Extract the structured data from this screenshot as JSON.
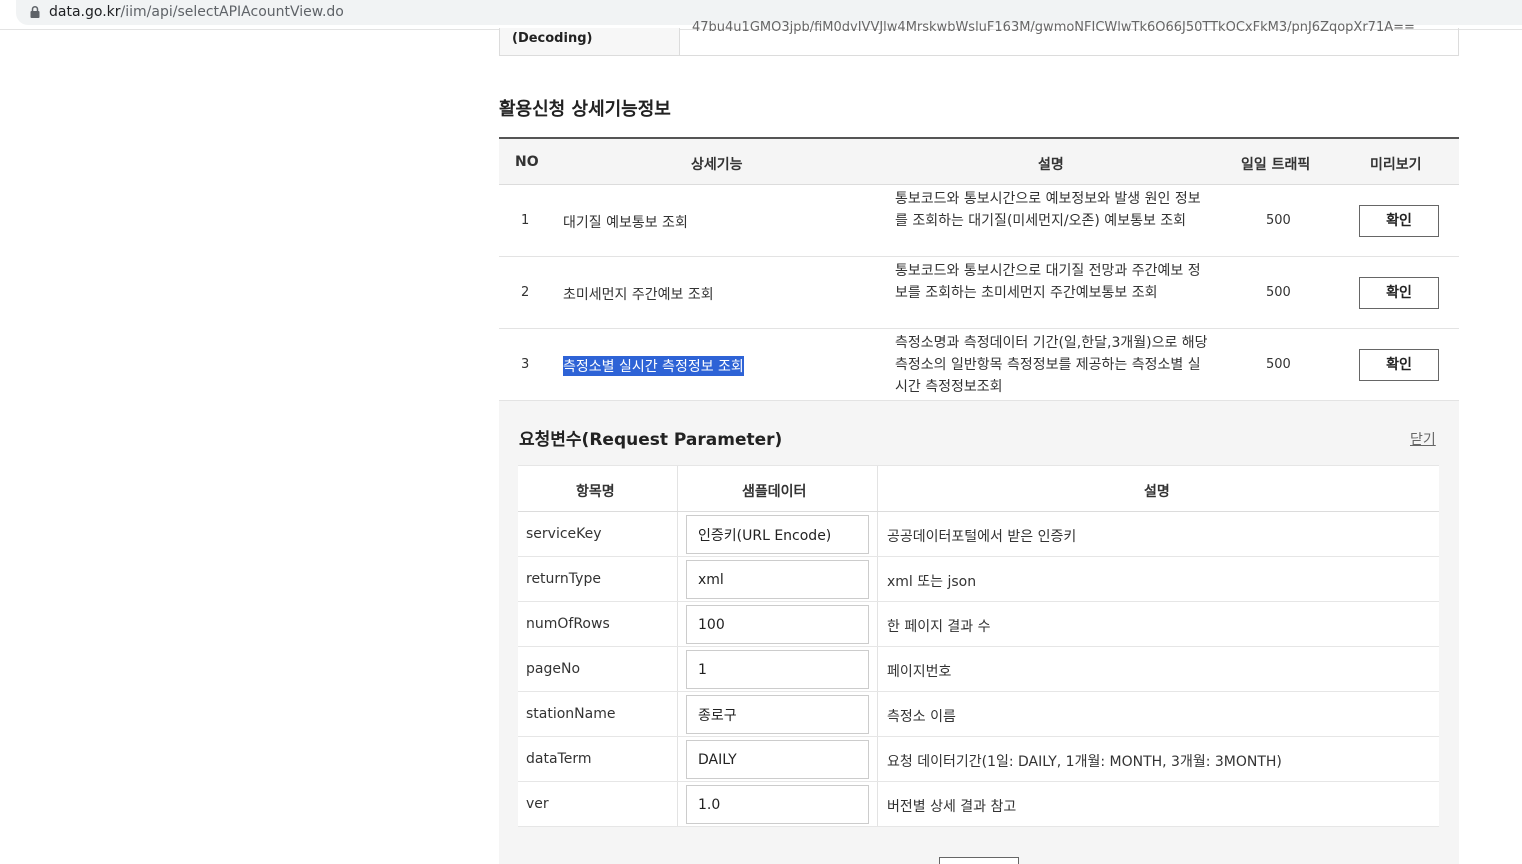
{
  "browser": {
    "url_host": "data.go.kr",
    "url_path": "/iim/api/selectAPIAcountView.do"
  },
  "key_row": {
    "label": "(Decoding)",
    "value": "47bu4u1GMO3jpb/fiM0dvIVVJlw4MrskwbWsluF163M/gwmoNFICWlwTk6O66J50TTkOCxFkM3/pnJ6ZqopXr71A=="
  },
  "feature_section": {
    "title": "활용신청 상세기능정보",
    "headers": {
      "no": "NO",
      "feature": "상세기능",
      "desc": "설명",
      "traffic": "일일 트래픽",
      "preview": "미리보기"
    },
    "rows": [
      {
        "no": "1",
        "name": "대기질 예보통보 조회",
        "desc": "통보코드와 통보시간으로 예보정보와 발생 원인 정보를 조회하는 대기질(미세먼지/오존) 예보통보 조회",
        "traffic": "500",
        "button": "확인",
        "selected": false
      },
      {
        "no": "2",
        "name": "초미세먼지 주간예보 조회",
        "desc": "통보코드와 통보시간으로 대기질 전망과 주간예보 정보를 조회하는 초미세먼지 주간예보통보 조회",
        "traffic": "500",
        "button": "확인",
        "selected": false
      },
      {
        "no": "3",
        "name": "측정소별 실시간 측정정보 조회",
        "desc": "측정소명과 측정데이터 기간(일,한달,3개월)으로 해당 측정소의 일반항목 측정정보를 제공하는 측정소별 실시간 측정정보조회",
        "traffic": "500",
        "button": "확인",
        "selected": true
      }
    ]
  },
  "request_panel": {
    "title": "요청변수(Request Parameter)",
    "close_label": "닫기",
    "headers": {
      "name": "항목명",
      "sample": "샘플데이터",
      "desc": "설명"
    },
    "params": [
      {
        "name": "serviceKey",
        "value": "인증키(URL Encode)",
        "desc": "공공데이터포털에서 받은 인증키"
      },
      {
        "name": "returnType",
        "value": "xml",
        "desc": "xml 또는 json"
      },
      {
        "name": "numOfRows",
        "value": "100",
        "desc": "한 페이지 결과 수"
      },
      {
        "name": "pageNo",
        "value": "1",
        "desc": "페이지번호"
      },
      {
        "name": "stationName",
        "value": "종로구",
        "desc": "측정소 이름"
      },
      {
        "name": "dataTerm",
        "value": "DAILY",
        "desc": "요청 데이터기간(1일: DAILY, 1개월: MONTH, 3개월: 3MONTH)"
      },
      {
        "name": "ver",
        "value": "1.0",
        "desc": "버전별 상세 결과 참고"
      }
    ]
  }
}
